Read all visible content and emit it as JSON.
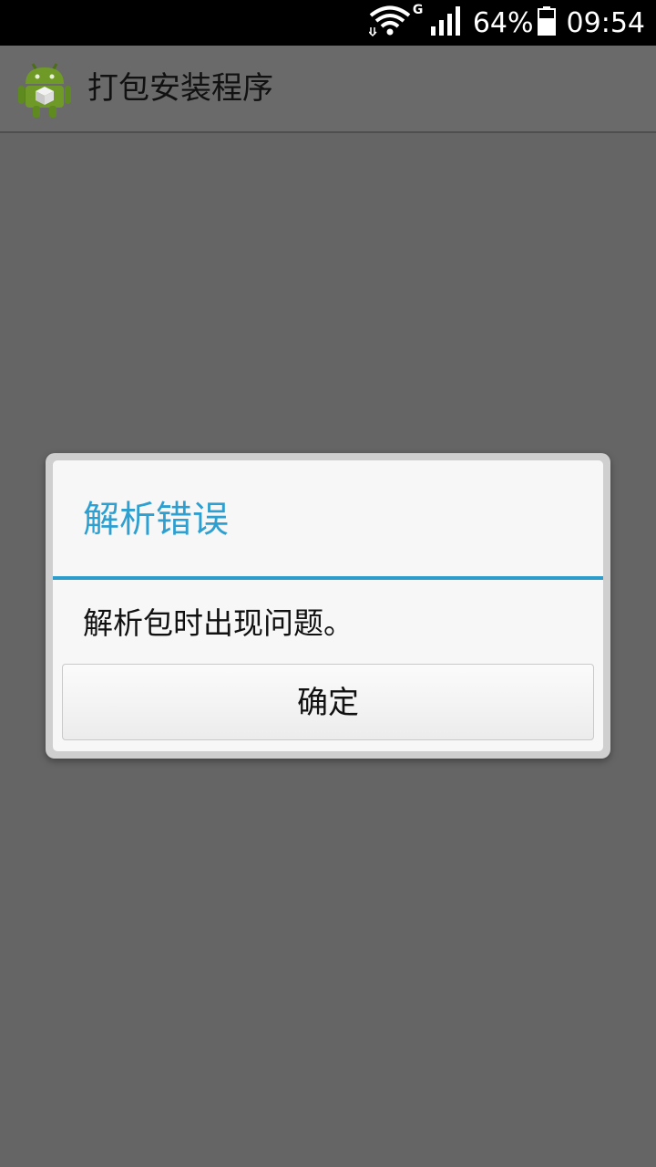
{
  "status_bar": {
    "network_type": "G",
    "battery_percent": "64%",
    "time": "09:54",
    "icons": [
      "wifi-icon",
      "signal-icon",
      "battery-icon"
    ]
  },
  "app_bar": {
    "title": "打包安装程序",
    "icon": "android-package-icon"
  },
  "dialog": {
    "title": "解析错误",
    "message": "解析包时出现问题。",
    "ok_label": "确定"
  },
  "colors": {
    "accent": "#2d9fd0",
    "background": "#656565",
    "dialog_bg": "#f7f7f7"
  }
}
